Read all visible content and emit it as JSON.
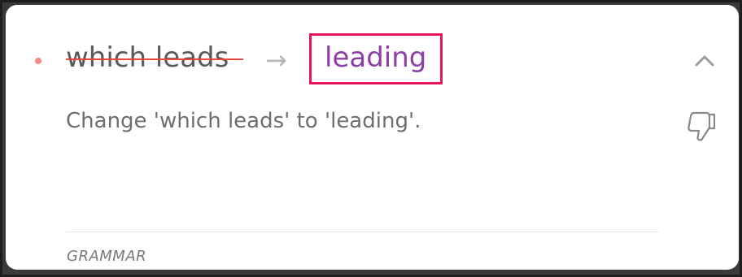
{
  "suggestion": {
    "original_text": "which leads",
    "replacement_text": "leading",
    "arrow_glyph": "→",
    "description": "Change 'which leads' to 'leading'.",
    "category": "GRAMMAR"
  },
  "icons": {
    "bullet": "bullet-dot-icon",
    "arrow": "arrow-right-icon",
    "collapse": "chevron-up-icon",
    "dislike": "thumbs-down-icon"
  },
  "colors": {
    "bullet": "#f28b82",
    "strikethrough": "#e8453c",
    "replacement": "#8e3ea8",
    "highlight_box": "#e5175a"
  }
}
